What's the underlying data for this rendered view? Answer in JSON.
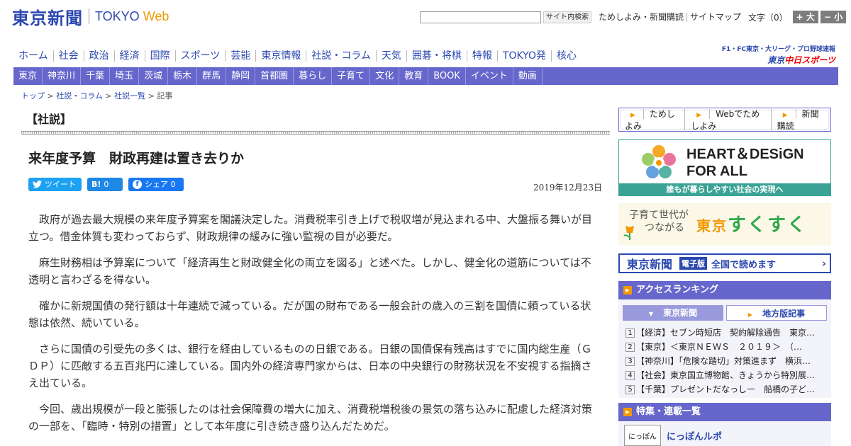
{
  "header": {
    "logo_jp": "東京新聞",
    "logo_en1": "TOKYO",
    "logo_en2": "Web",
    "search_button": "サイト内検索",
    "links": [
      "ためしよみ・新聞購読",
      "サイトマップ"
    ],
    "fontsize_label": "文字（0）",
    "font_big": "+ 大",
    "font_small": "− 小"
  },
  "global_nav": [
    "ホーム",
    "社会",
    "政治",
    "経済",
    "国際",
    "スポーツ",
    "芸能",
    "東京情報",
    "社説・コラム",
    "天気",
    "囲碁・将棋",
    "特報",
    "TOKYO発",
    "核心"
  ],
  "chunichi": {
    "line1": "F1・FC東京・大リーグ・プロ野球速報",
    "prefix": "東京",
    "name": "中日スポーツ"
  },
  "local_nav": [
    "東京",
    "神奈川",
    "千葉",
    "埼玉",
    "茨城",
    "栃木",
    "群馬",
    "静岡",
    "首都圏",
    "暮らし",
    "子育て",
    "文化",
    "教育",
    "BOOK",
    "イベント",
    "動画"
  ],
  "breadcrumb": {
    "items": [
      "トップ",
      "社説・コラム",
      "社説一覧"
    ],
    "current": "記事",
    "sep": ">"
  },
  "article": {
    "section": "【社説】",
    "title": "来年度予算　財政再建は置き去りか",
    "share": {
      "tweet": "ツイート",
      "hatena": "0",
      "facebook": "シェア 0",
      "hatena_icon": "B!",
      "fb_icon": "f"
    },
    "date": "2019年12月23日",
    "paragraphs": [
      "政府が過去最大規模の来年度予算案を閣議決定した。消費税率引き上げで税収増が見込まれる中、大盤振る舞いが目立つ。借金体質も変わっておらず、財政規律の緩みに強い監視の目が必要だ。",
      "麻生財務相は予算案について「経済再生と財政健全化の両立を図る」と述べた。しかし、健全化の道筋については不透明と言わざるを得ない。",
      "確かに新規国債の発行額は十年連続で減っている。だが国の財布である一般会計の歳入の三割を国債に頼っている状態は依然、続いている。",
      "さらに国債の引受先の多くは、銀行を経由しているものの日銀である。日銀の国債保有残高はすでに国内総生産（ＧＤＰ）に匹敵する五百兆円に達している。国内外の経済専門家からは、日本の中央銀行の財務状況を不安視する指摘さえ出ている。",
      "今回、歳出規模が一段と膨張したのは社会保障費の増大に加え、消費税増税後の景気の落ち込みに配慮した経済対策の一部を、「臨時・特別の措置」として本年度に引き続き盛り込んだためだ。"
    ]
  },
  "sidebar": {
    "trial_links": [
      "ためしよみ",
      "Webでためしよみ",
      "新聞購読"
    ],
    "heart": {
      "line1": "HEART＆DESiGN",
      "line2": "FOR ALL",
      "bar": "誰もが暮らしやすい社会の実現へ"
    },
    "sukusuku": {
      "small1": "子育て世代が",
      "small2": "つながる",
      "tokyo": "東京",
      "name": "すくすく"
    },
    "digital": {
      "logo": "東京新聞",
      "badge": "電子版",
      "text": "全国で読めます",
      "chevron": "›"
    },
    "ranking": {
      "title": "アクセスランキング",
      "tab_active": "東京新聞",
      "tab_other": "地方版記事",
      "items": [
        "【経済】セブン時短店　契約解除通告　東京の店…",
        "【東京】＜東京ＮＥＷＳ　２０１９＞　（…",
        "【神奈川】「危険な踏切」対策進まず　横浜…",
        "【社会】東京国立博物館、きょうから特別展…",
        "【千葉】プレゼントだなっしー　船橋の子ども…"
      ]
    },
    "features": {
      "title": "特集・連載一覧",
      "thumb": "にっぽん",
      "item": "にっぽんルポ"
    }
  },
  "colors": {
    "brand_blue": "#2c48b0",
    "local_nav": "#6666cc",
    "accent_orange": "#f39800",
    "teal": "#3aa395",
    "green": "#2ea84a"
  }
}
